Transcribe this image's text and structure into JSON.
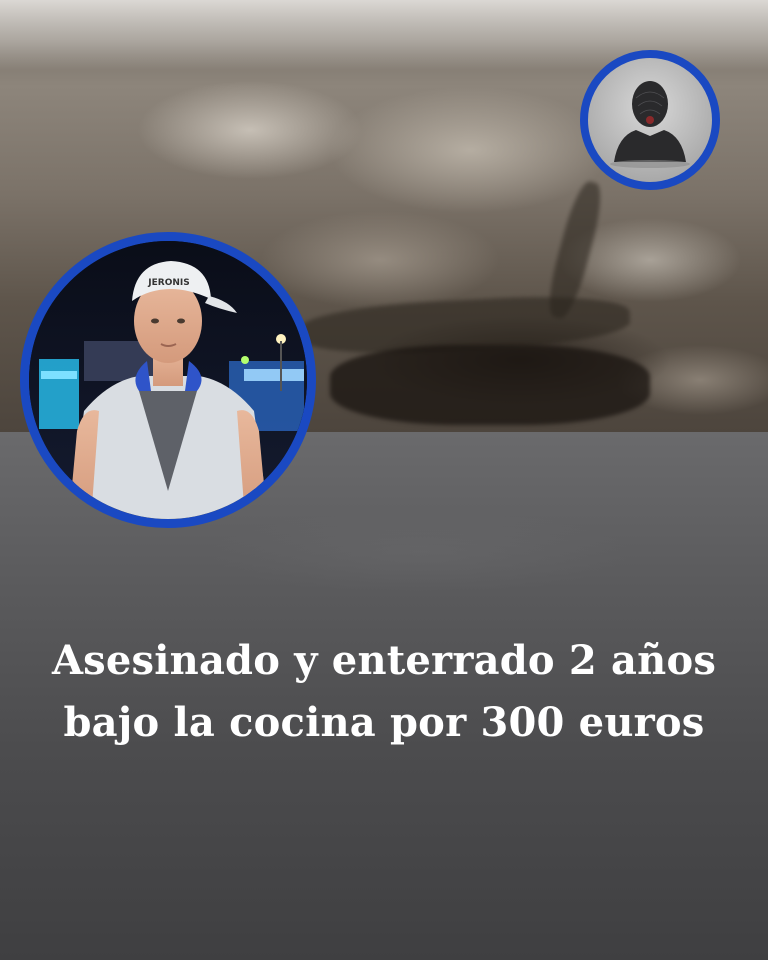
{
  "headline": {
    "line1": "Asesinado y enterrado 2 años",
    "line2": "bajo la cocina por 300 euros"
  },
  "portrait": {
    "cap_text": "JERONIS",
    "ring_color": "#1a49c2"
  },
  "silhouette": {
    "icon": "anonymous-person-silhouette-icon",
    "ring_color": "#1a49c2"
  }
}
